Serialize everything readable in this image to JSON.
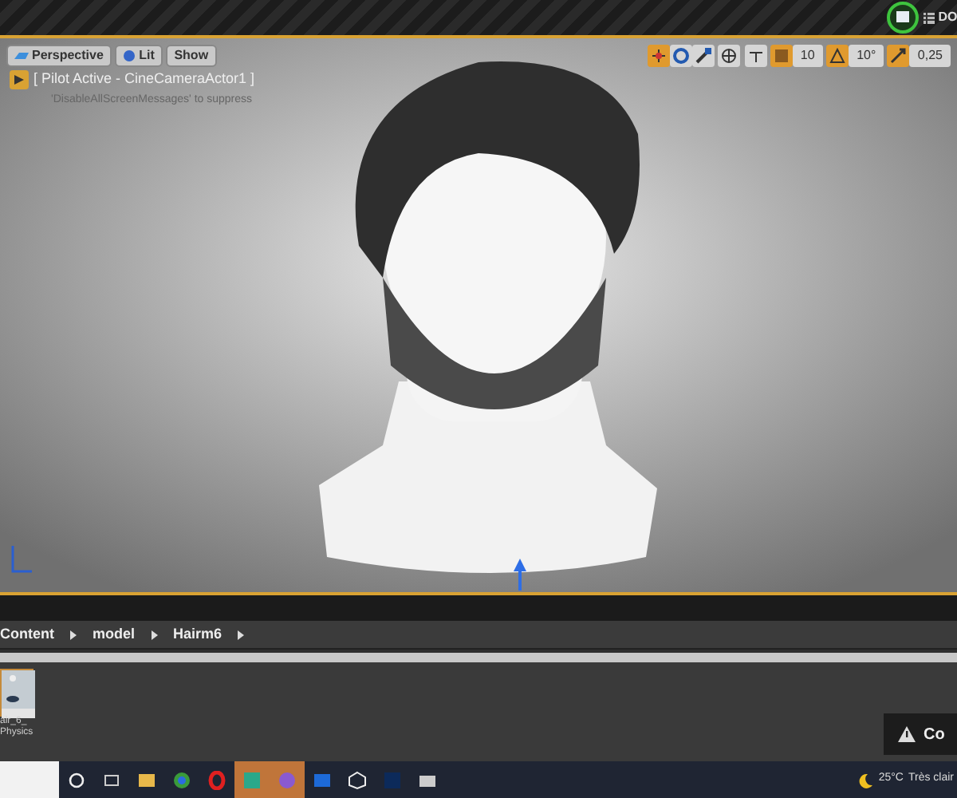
{
  "top_bar": {
    "tab_label": "DO"
  },
  "viewport": {
    "buttons": [
      "Perspective",
      "Lit",
      "Show"
    ],
    "transform_tools": [
      {
        "selected": true
      },
      {
        "selected": false
      },
      {
        "selected": false
      }
    ],
    "snaps": [
      {
        "on": true,
        "value": "10"
      },
      {
        "on": true,
        "value": "10°"
      },
      {
        "on": true,
        "value": "0,25"
      }
    ],
    "pilot_label": "[ Pilot Active - CineCameraActor1 ]",
    "message": "'DisableAllScreenMessages' to suppress"
  },
  "breadcrumbs": [
    "Content",
    "model",
    "Hairm6"
  ],
  "assets": [
    {
      "name_lines": [
        "air_6_",
        "Physics"
      ]
    }
  ],
  "toast": {
    "text": "Co"
  },
  "taskbar": {
    "apps": [
      {
        "active": false
      },
      {
        "active": false
      },
      {
        "active": false
      },
      {
        "active": false
      },
      {
        "active": false
      },
      {
        "active": true
      },
      {
        "active": true
      },
      {
        "active": false
      },
      {
        "active": false
      },
      {
        "active": false
      },
      {
        "active": false
      }
    ],
    "weather": "25°C",
    "weather_text": "Très clair"
  }
}
